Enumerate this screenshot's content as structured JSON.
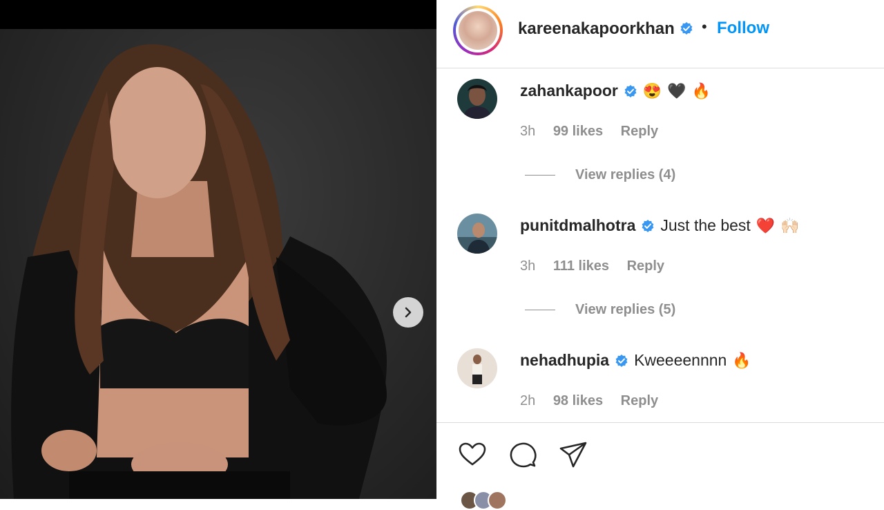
{
  "post": {
    "photo_alt": "Woman in black blazer posing against dark backdrop",
    "next_icon": "chevron-right-icon"
  },
  "header": {
    "username": "kareenakapoorkhan",
    "separator": "•",
    "follow_label": "Follow"
  },
  "comments": [
    {
      "username": "zahankapoor",
      "text": "",
      "emojis": [
        "😍",
        "🖤",
        "🔥"
      ],
      "time": "3h",
      "likes": "99 likes",
      "reply_label": "Reply",
      "view_replies": "View replies (4)"
    },
    {
      "username": "punitdmalhotra",
      "text": "Just the best",
      "emojis": [
        "❤️",
        "🙌🏻"
      ],
      "time": "3h",
      "likes": "111 likes",
      "reply_label": "Reply",
      "view_replies": "View replies (5)"
    },
    {
      "username": "nehadhupia",
      "text": "Kweeeennnn",
      "emojis": [
        "🔥"
      ],
      "time": "2h",
      "likes": "98 likes",
      "reply_label": "Reply"
    }
  ],
  "actions": {
    "like_icon": "heart-icon",
    "comment_icon": "comment-icon",
    "share_icon": "share-icon"
  },
  "colors": {
    "follow": "#0095f6",
    "verified": "#3897f0",
    "secondary_text": "#8e8e8e"
  }
}
